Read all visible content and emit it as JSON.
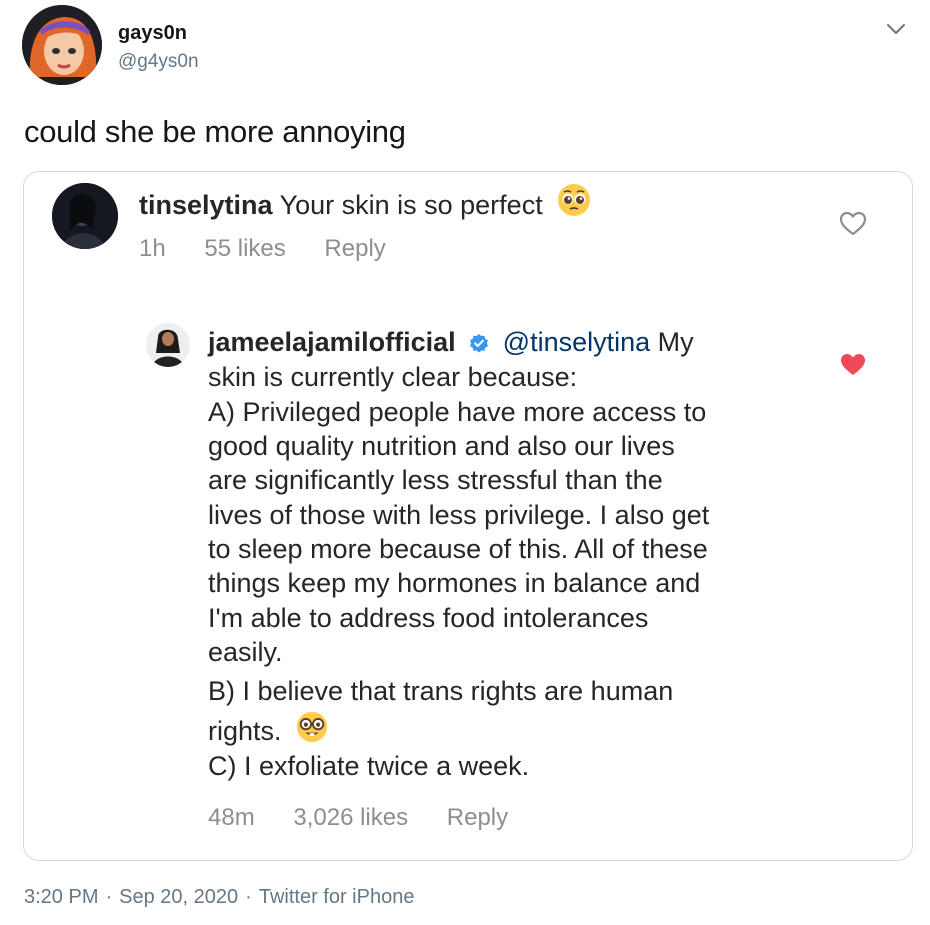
{
  "tweet": {
    "author": {
      "display_name": "gays0n",
      "handle": "@g4ys0n",
      "avatar_icon": "cartoon-avatar-icon"
    },
    "text": "could she be more annoying",
    "menu_icon": "chevron-down-icon",
    "timestamp": {
      "time": "3:20 PM",
      "separator1": "·",
      "date": "Sep 20, 2020",
      "separator2": "·",
      "source": "Twitter for iPhone"
    }
  },
  "embedded_screenshot": {
    "comments": [
      {
        "username": "tinselytina",
        "text": "Your skin is so perfect",
        "emoji": "pleading-face-emoji",
        "time": "1h",
        "likes": "55 likes",
        "reply_label": "Reply",
        "liked": false,
        "heart_color": "#8e8e8e"
      },
      {
        "username": "jameelajamilofficial",
        "verified": true,
        "mention": "@tinselytina",
        "lines": [
          "My",
          "skin is currently clear because:",
          "A) Privileged people have more access to",
          "good quality nutrition and also our lives",
          "are significantly less stressful than the",
          "lives of those with less privilege. I also get",
          "to sleep more because of this. All of these",
          "things keep my hormones in balance and",
          "I'm able to address food intolerances",
          "easily.",
          "B) I believe that trans rights are human",
          "rights.",
          "C) I exfoliate twice a week."
        ],
        "emoji": "nerd-face-emoji",
        "time": "48m",
        "likes": "3,026 likes",
        "reply_label": "Reply",
        "liked": true,
        "heart_color": "#ed4956",
        "verified_color": "#3897f0"
      }
    ]
  }
}
